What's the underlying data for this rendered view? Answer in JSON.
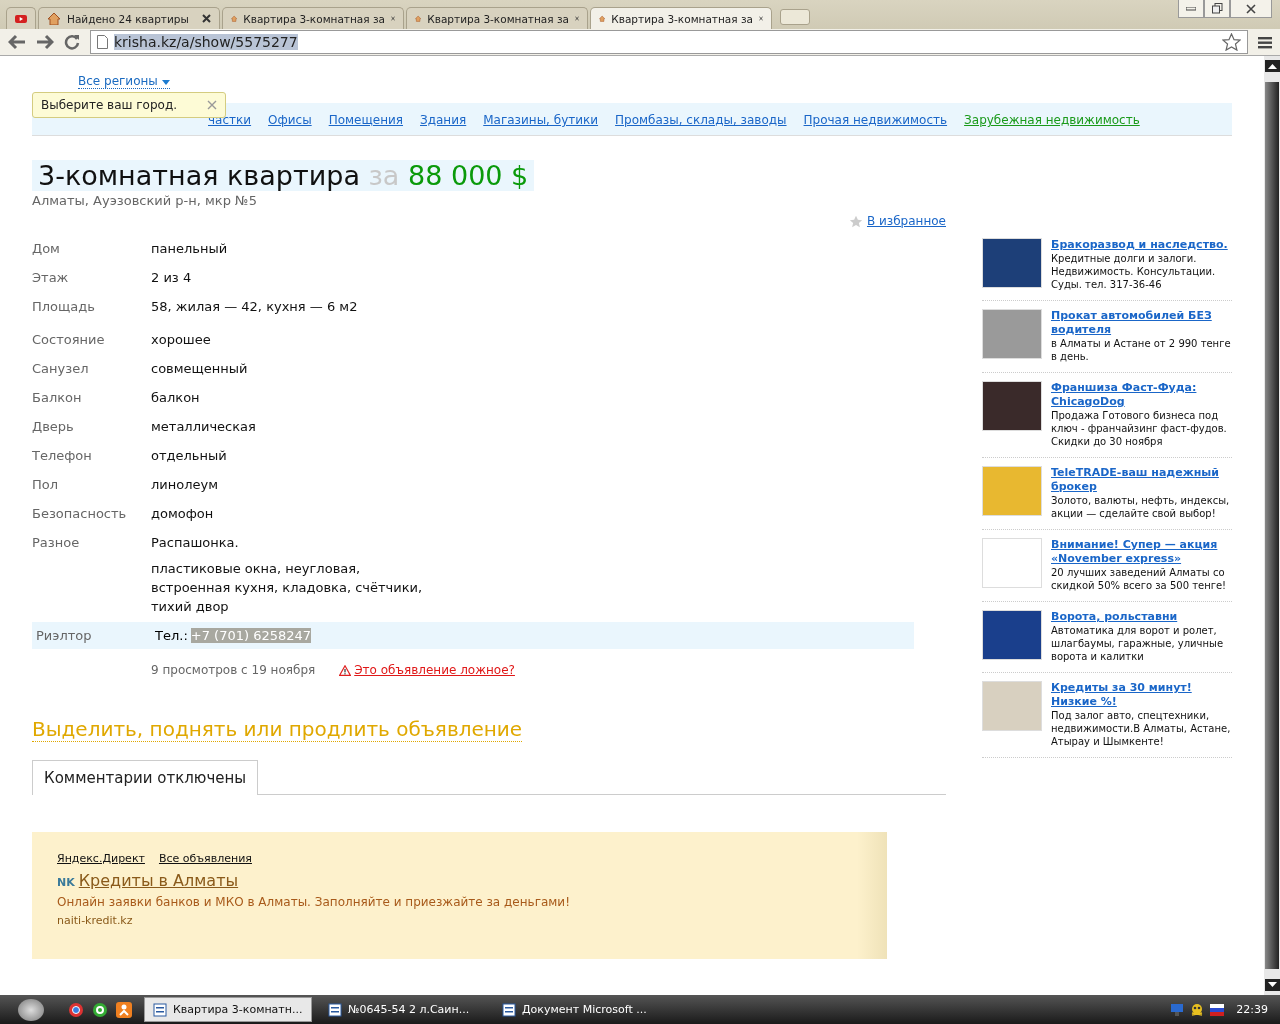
{
  "browser": {
    "tabs": [
      {
        "kind": "video",
        "selected": false
      },
      {
        "kind": "page",
        "label": "Найдено 24 квартиры",
        "selected": false
      },
      {
        "kind": "page",
        "label": "Квартира 3-комнатная за",
        "selected": false
      },
      {
        "kind": "page",
        "label": "Квартира 3-комнатная за",
        "selected": false
      },
      {
        "kind": "page",
        "label": "Квартира 3-комнатная за",
        "selected": true
      }
    ],
    "address": "krisha.kz/a/show/5575277"
  },
  "region_link": "Все регионы",
  "tooltip": "Выберите ваш город.",
  "nav": [
    {
      "label": "частки",
      "kind": "local"
    },
    {
      "label": "Офисы",
      "kind": "local"
    },
    {
      "label": "Помещения",
      "kind": "local"
    },
    {
      "label": "Здания",
      "kind": "local"
    },
    {
      "label": "Магазины, бутики",
      "kind": "local"
    },
    {
      "label": "Промбазы, склады, заводы",
      "kind": "local"
    },
    {
      "label": "Прочая недвижимость",
      "kind": "local"
    },
    {
      "label": "Зарубежная недвижимость",
      "kind": "foreign"
    }
  ],
  "listing": {
    "title": "3-комнатная квартира",
    "price_prefix": "за",
    "price": "88 000 $",
    "address": "Алматы, Ауэзовский р-н, мкр №5",
    "favorite": "В избранное",
    "details": [
      {
        "label": "Дом",
        "value": "панельный"
      },
      {
        "label": "Этаж",
        "value": "2 из 4"
      },
      {
        "label": "Площадь",
        "value": "58, жилая — 42, кухня — 6 м2"
      },
      {
        "label": "Состояние",
        "value": "хорошее"
      },
      {
        "label": "Санузел",
        "value": "совмещенный"
      },
      {
        "label": "Балкон",
        "value": "балкон"
      },
      {
        "label": "Дверь",
        "value": "металлическая"
      },
      {
        "label": "Телефон",
        "value": "отдельный"
      },
      {
        "label": "Пол",
        "value": "линолеум"
      },
      {
        "label": "Безопасность",
        "value": "домофон"
      },
      {
        "label": "Разное",
        "value": "Распашонка."
      }
    ],
    "notes": [
      "пластиковые окна, неугловая,",
      "встроенная кухня, кладовка, счётчики,",
      "тихий двор"
    ],
    "contact": {
      "label": "Риэлтор",
      "phone_label": "Тел.:",
      "phone": "+7 (701) 6258247"
    },
    "views": "9 просмотров с 19 ноября",
    "report": "Это объявление ложное?",
    "promote": "Выделить, поднять или продлить объявление",
    "comments_tab": "Комментарии отключены"
  },
  "direct_ad": {
    "links": [
      "Яндекс.Директ",
      "Все объявления"
    ],
    "badge": "NK",
    "title": "Кредиты в Алматы",
    "text": "Онлайн заявки банков и МКО в Алматы. Заполняйте и приезжайте за деньгами!",
    "domain": "naiti-kredit.kz"
  },
  "side_ads": [
    {
      "title": "Бракоразвод и наследство.",
      "text": "Кредитные долги и залоги. Недвижимость. Консультации. Суды. тел. 317-36-46"
    },
    {
      "title": "Прокат автомобилей БЕЗ водителя",
      "text": "в Алматы и Астане от 2 990 тенге в день."
    },
    {
      "title": "Франшиза Фаст-Фуда: ChicagoDog",
      "text": "Продажа Готового бизнеса под ключ - франчайзинг фаст-фудов. Скидки до 30 ноября"
    },
    {
      "title": "TeleTRADE-ваш надежный брокер",
      "text": "Золото, валюты, нефть, индексы, акции — сделайте свой выбор!"
    },
    {
      "title": "Внимание! Супер — акция «November express»",
      "text": "20 лучших заведений Алматы со скидкой 50% всего за 500 тенге!"
    },
    {
      "title": "Ворота, рольставни ",
      "text": "Автоматика для ворот и ролет, шлагбаумы, гаражные, уличные ворота и калитки"
    },
    {
      "title": "Кредиты за 30 минут! Низкие %!",
      "text": "Под залог авто, спецтехники, недвижимости.В Алматы, Астане, Атырау и Шымкенте!"
    }
  ],
  "taskbar": {
    "tasks": [
      {
        "label": "Квартира 3-комнатн...",
        "selected": true
      },
      {
        "label": "№0645-54 2 л.Саин...",
        "selected": false
      },
      {
        "label": "Документ Microsoft ...",
        "selected": false
      }
    ],
    "clock": "22:39"
  }
}
